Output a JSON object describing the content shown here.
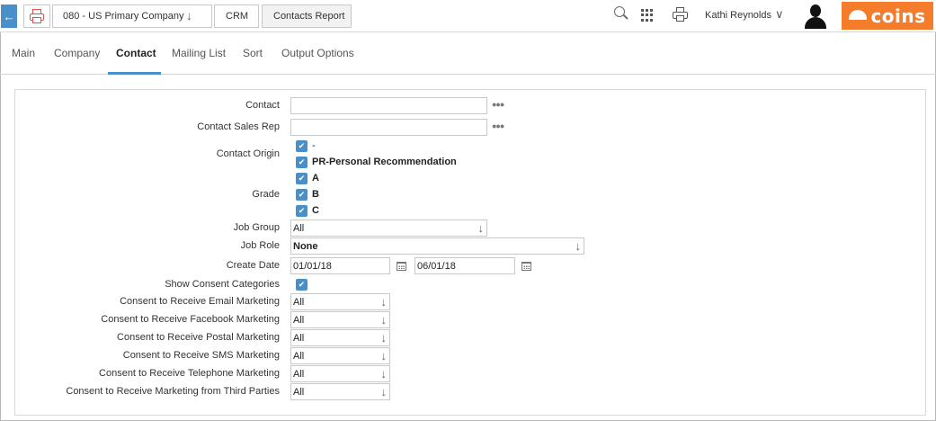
{
  "breadcrumb": {
    "company": "080 - US Primary Company",
    "module": "CRM",
    "report": "Contacts Report"
  },
  "header": {
    "user_name": "Kathi Reynolds",
    "logo_text": "coins"
  },
  "tabs": [
    {
      "label": "Main"
    },
    {
      "label": "Company"
    },
    {
      "label": "Contact"
    },
    {
      "label": "Mailing List"
    },
    {
      "label": "Sort"
    },
    {
      "label": "Output Options"
    }
  ],
  "active_tab": "Contact",
  "form": {
    "contact": {
      "label": "Contact",
      "value": ""
    },
    "contact_sales_rep": {
      "label": "Contact Sales Rep",
      "value": ""
    },
    "contact_origin": {
      "label": "Contact Origin",
      "options": [
        {
          "label": "-",
          "checked": true
        },
        {
          "label": "PR-Personal Recommendation",
          "checked": true
        }
      ]
    },
    "grade": {
      "label": "Grade",
      "options": [
        {
          "label": "A",
          "checked": true
        },
        {
          "label": "B",
          "checked": true
        },
        {
          "label": "C",
          "checked": true
        }
      ]
    },
    "job_group": {
      "label": "Job Group",
      "value": "All"
    },
    "job_role": {
      "label": "Job Role",
      "value": "None"
    },
    "create_date": {
      "label": "Create Date",
      "from": "01/01/18",
      "to": "06/01/18"
    },
    "show_consent": {
      "label": "Show Consent Categories",
      "checked": true
    },
    "consents": [
      {
        "label": "Consent to Receive Email Marketing",
        "value": "All"
      },
      {
        "label": "Consent to Receive Facebook Marketing",
        "value": "All"
      },
      {
        "label": "Consent to Receive Postal Marketing",
        "value": "All"
      },
      {
        "label": "Consent to Receive SMS Marketing",
        "value": "All"
      },
      {
        "label": "Consent to Receive Telephone Marketing",
        "value": "All"
      },
      {
        "label": "Consent to Receive Marketing from Third Parties",
        "value": "All"
      }
    ]
  },
  "colors": {
    "accent": "#4a90c8",
    "brand": "#f47c2a",
    "print_icon": "#d9534f"
  }
}
